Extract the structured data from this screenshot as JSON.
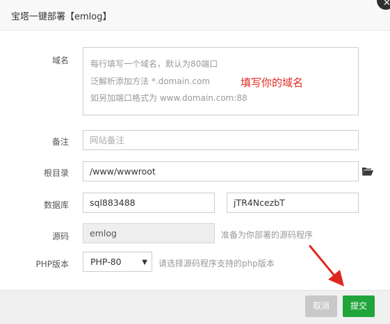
{
  "dialog": {
    "title": "宝塔一键部署【emlog】"
  },
  "form": {
    "domain": {
      "label": "域名",
      "placeholder_lines": [
        "每行填写一个域名，默认为80端口",
        "泛解析添加方法 *.domain.com",
        "如另加端口格式为 www.domain.com:88"
      ],
      "annotation": "填写你的域名"
    },
    "remark": {
      "label": "备注",
      "placeholder": "网站备注"
    },
    "root": {
      "label": "根目录",
      "value": "/www/wwwroot"
    },
    "database": {
      "label": "数据库",
      "user": "sql883488",
      "password": "jTR4NcezbT"
    },
    "source": {
      "label": "源码",
      "value": "emlog",
      "hint": "准备为你部署的源码程序"
    },
    "php": {
      "label": "PHP版本",
      "selected": "PHP-80",
      "hint": "请选择源码程序支持的php版本"
    }
  },
  "footer": {
    "cancel_label": "取消",
    "submit_label": "提交"
  },
  "icons": {
    "close": "close-icon",
    "folder": "folder-open-icon",
    "caret": "caret-down-icon",
    "arrow": "red-arrow-annotation"
  },
  "colors": {
    "submit": "#20a53a",
    "cancel": "#c9c9c9",
    "annotation": "#e0271f"
  }
}
